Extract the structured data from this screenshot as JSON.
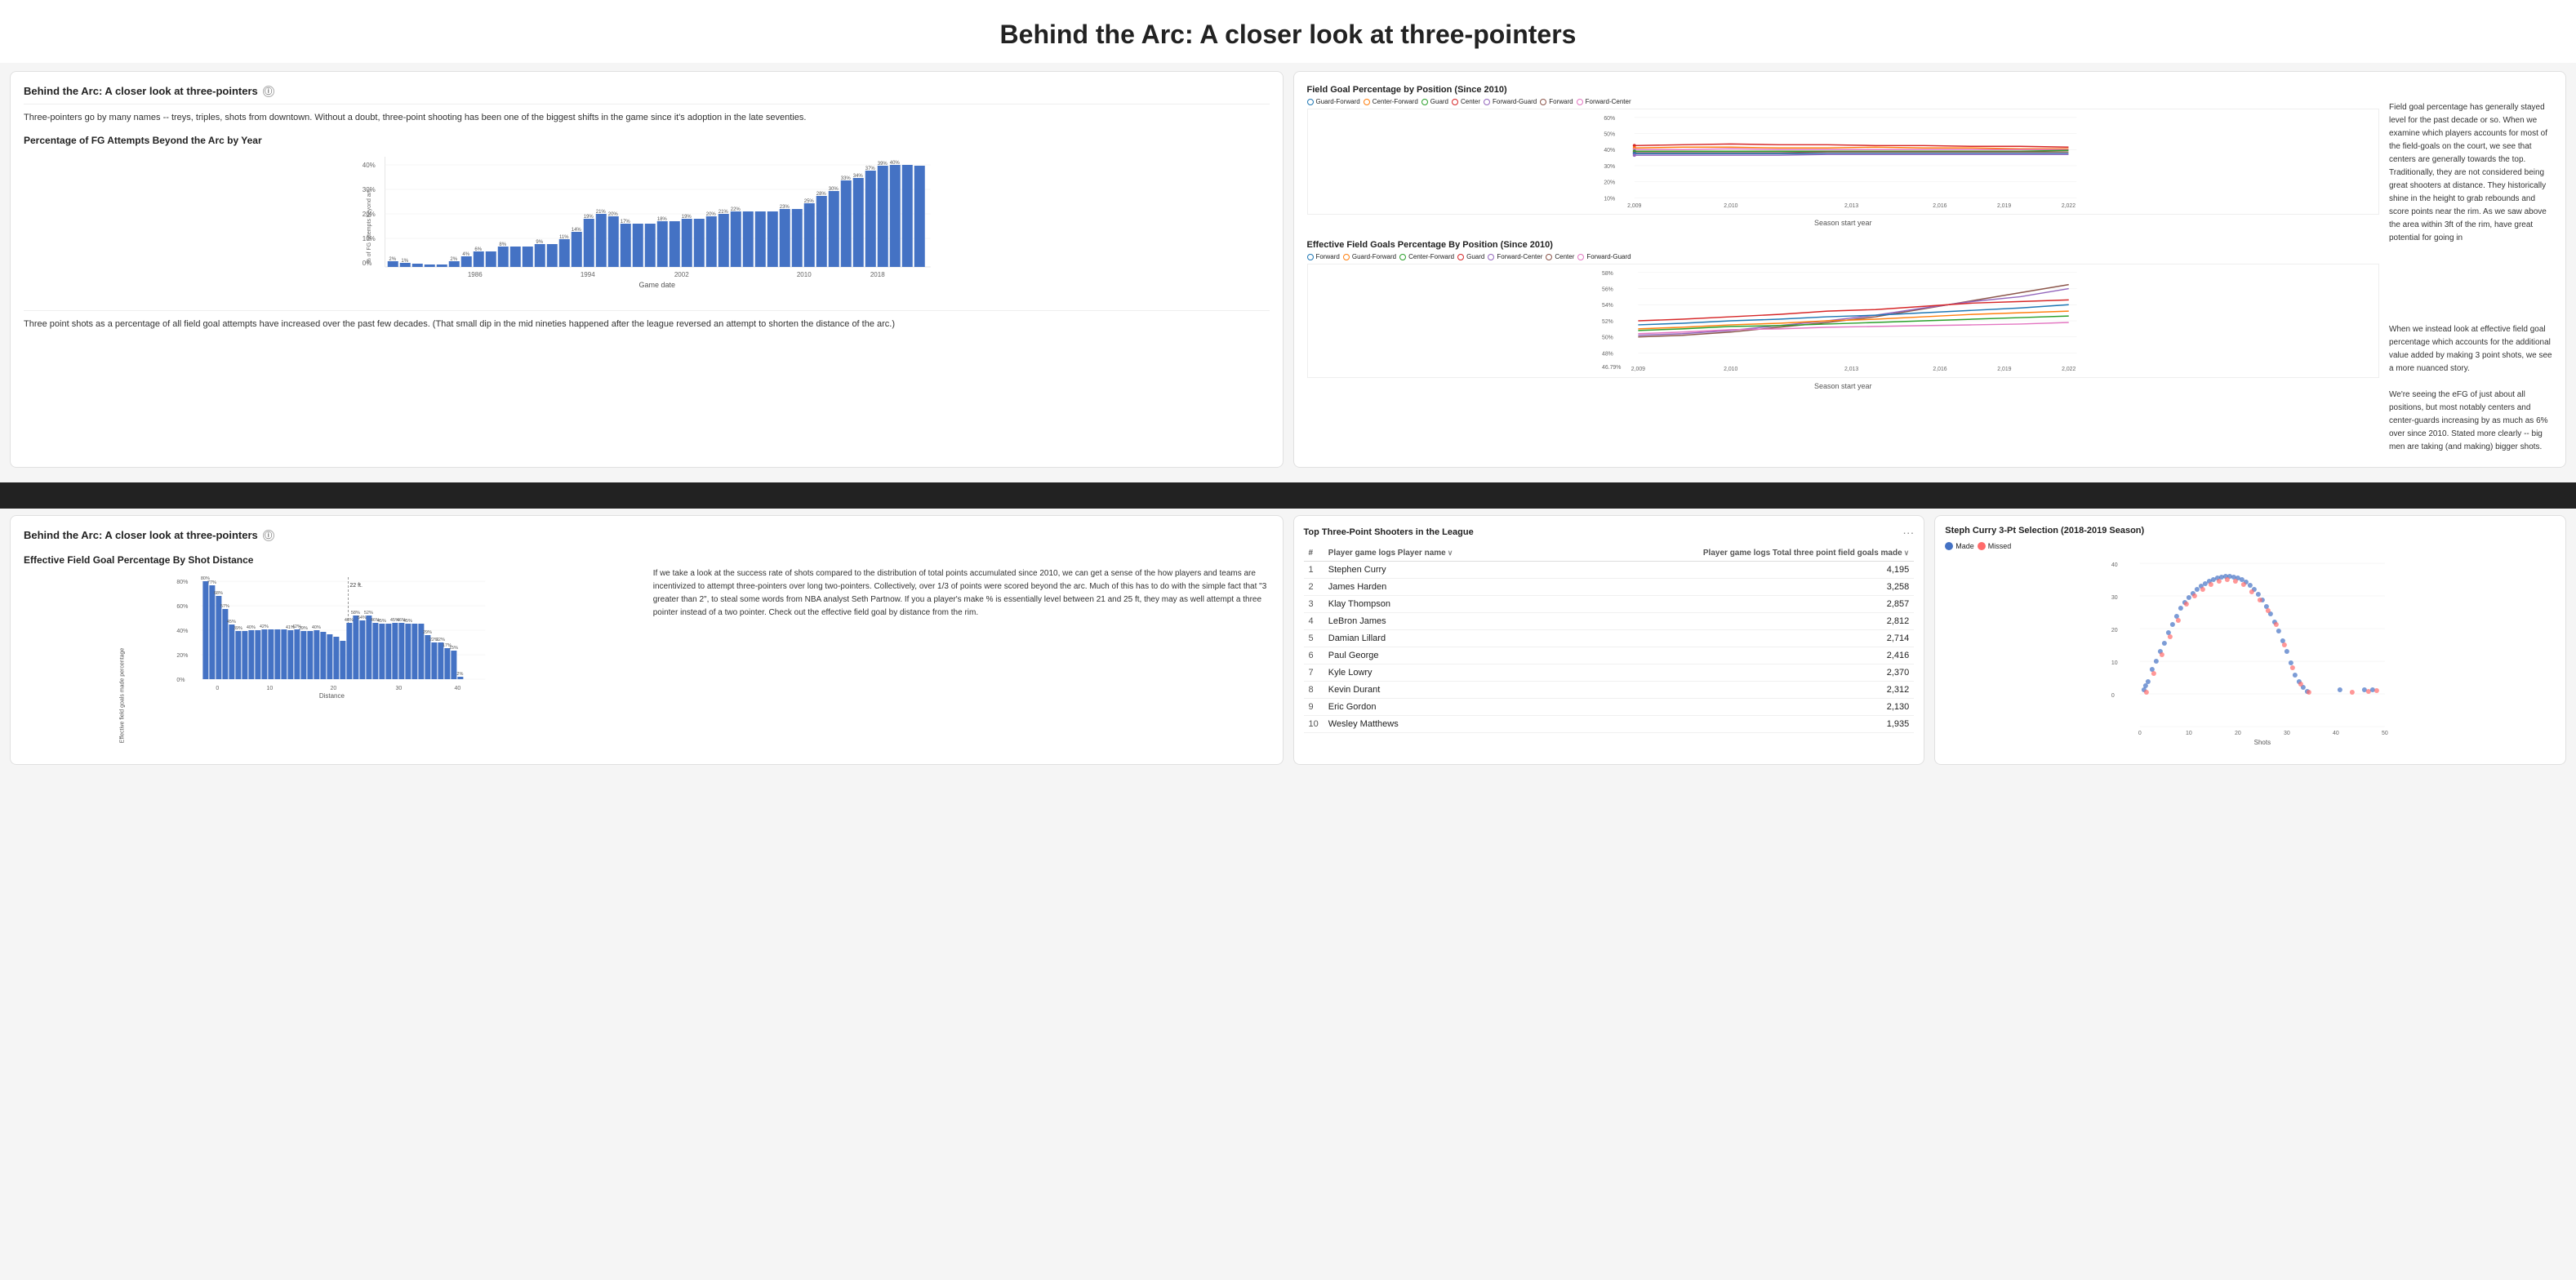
{
  "page": {
    "title": "Behind the Arc: A closer look at three-pointers"
  },
  "top_left": {
    "panel_title": "Behind the Arc: A closer look at three-pointers",
    "intro_text": "Three-pointers go by many names -- treys, triples, shots from downtown. Without a doubt, three-point shooting has been one of the biggest shifts in the game since it's adoption in the late seventies.",
    "chart_title": "Percentage of FG Attempts Beyond the Arc by Year",
    "y_axis_label": "% of FG attempts beyond arc",
    "x_axis_label": "Game date",
    "footer_text": "Three point shots as a percentage of all field goal attempts have increased over the past few decades. (That small dip in the mid nineties happened after the league reversed an attempt to shorten the distance of the arc.)",
    "bar_data": [
      {
        "year": "1980",
        "value": 2,
        "label": "2%"
      },
      {
        "year": "1981",
        "value": 1,
        "label": "1%"
      },
      {
        "year": "1982",
        "value": 0.7,
        "label": "0.7%"
      },
      {
        "year": "1983",
        "value": 0.3,
        "label": "0.3%"
      },
      {
        "year": "1984",
        "value": 0.2,
        "label": "0.2%"
      },
      {
        "year": "1985",
        "value": 2,
        "label": "2%"
      },
      {
        "year": "1986",
        "value": 4,
        "label": "4%"
      },
      {
        "year": "1987",
        "value": 6,
        "label": "6%"
      },
      {
        "year": "1988",
        "value": 6,
        "label": "6%"
      },
      {
        "year": "1989",
        "value": 8,
        "label": "8%"
      },
      {
        "year": "1990",
        "value": 8,
        "label": "8%"
      },
      {
        "year": "1991",
        "value": 8,
        "label": "8%"
      },
      {
        "year": "1992",
        "value": 9,
        "label": "9%"
      },
      {
        "year": "1993",
        "value": 9,
        "label": "9%"
      },
      {
        "year": "1994",
        "value": 11,
        "label": "11%"
      },
      {
        "year": "1995",
        "value": 14,
        "label": "14%"
      },
      {
        "year": "1996",
        "value": 19,
        "label": "19%"
      },
      {
        "year": "1997",
        "value": 21,
        "label": "21%"
      },
      {
        "year": "1998",
        "value": 20,
        "label": "20%"
      },
      {
        "year": "1999",
        "value": 17,
        "label": "17%"
      },
      {
        "year": "2000",
        "value": 17,
        "label": "17%"
      },
      {
        "year": "2001",
        "value": 17,
        "label": "17%"
      },
      {
        "year": "2002",
        "value": 18,
        "label": "18%"
      },
      {
        "year": "2003",
        "value": 18,
        "label": "18%"
      },
      {
        "year": "2004",
        "value": 19,
        "label": "19%"
      },
      {
        "year": "2005",
        "value": 19,
        "label": "19%"
      },
      {
        "year": "2006",
        "value": 20,
        "label": "20%"
      },
      {
        "year": "2007",
        "value": 21,
        "label": "21%"
      },
      {
        "year": "2008",
        "value": 22,
        "label": "22%"
      },
      {
        "year": "2009",
        "value": 22,
        "label": "22%"
      },
      {
        "year": "2010",
        "value": 22,
        "label": "22%"
      },
      {
        "year": "2011",
        "value": 22,
        "label": "22%"
      },
      {
        "year": "2012",
        "value": 23,
        "label": "23%"
      },
      {
        "year": "2013",
        "value": 23,
        "label": "23%"
      },
      {
        "year": "2014",
        "value": 25,
        "label": "25%"
      },
      {
        "year": "2015",
        "value": 28,
        "label": "28%"
      },
      {
        "year": "2016",
        "value": 30,
        "label": "30%"
      },
      {
        "year": "2017",
        "value": 33,
        "label": "33%"
      },
      {
        "year": "2018",
        "value": 34,
        "label": "34%"
      },
      {
        "year": "2019",
        "value": 37,
        "label": "37%"
      },
      {
        "year": "2020",
        "value": 39,
        "label": "39%"
      },
      {
        "year": "2021",
        "value": 40,
        "label": "40%"
      },
      {
        "year": "2022",
        "value": 40,
        "label": "40%"
      },
      {
        "year": "2023",
        "value": 39,
        "label": "39%"
      },
      {
        "year": "2024",
        "value": 39,
        "label": "39%"
      }
    ]
  },
  "top_right": {
    "chart1_title": "Field Goal Percentage by Position (Since 2010)",
    "chart1_legend": [
      {
        "label": "Guard-Forward",
        "color": "#1f77b4"
      },
      {
        "label": "Center-Forward",
        "color": "#ff7f0e"
      },
      {
        "label": "Guard",
        "color": "#2ca02c"
      },
      {
        "label": "Center",
        "color": "#d62728"
      },
      {
        "label": "Forward-Guard",
        "color": "#9467bd"
      },
      {
        "label": "Forward",
        "color": "#8c564b"
      },
      {
        "label": "Forward-Center",
        "color": "#e377c2"
      }
    ],
    "chart1_x_label": "Season start year",
    "chart1_y_max": 60,
    "chart2_title": "Effective Field Goals Percentage By Position (Since 2010)",
    "chart2_legend": [
      {
        "label": "Forward",
        "color": "#1f77b4"
      },
      {
        "label": "Guard-Forward",
        "color": "#ff7f0e"
      },
      {
        "label": "Center-Forward",
        "color": "#2ca02c"
      },
      {
        "label": "Guard",
        "color": "#d62728"
      },
      {
        "label": "Forward-Center",
        "color": "#9467bd"
      },
      {
        "label": "Center",
        "color": "#8c564b"
      },
      {
        "label": "Forward-Guard",
        "color": "#e377c2"
      }
    ],
    "chart2_x_label": "Season start year",
    "text1": "Field goal percentage has generally stayed level for the past decade or so. When we examine which players accounts for most of the field-goals on the court, we see that centers are generally towards the top. Traditionally, they are not considered being great shooters at distance. They historically shine in the height to grab rebounds and score points near the rim. As we saw above the area within 3ft of the rim, have great potential for going in",
    "text2": "When we instead look at effective field goal percentage which accounts for the additional value added by making 3 point shots, we see a more nuanced story.\n\nWe're seeing the eFG of just about all positions, but most notably centers and center-guards increasing by as much as 6% over since 2010. Stated more clearly -- big men are taking (and making) bigger shots."
  },
  "bottom_left": {
    "panel_title": "Behind the Arc: A closer look at three-pointers",
    "chart_title": "Effective Field Goal Percentage By Shot Distance",
    "y_axis_label": "Effective field goals made percentage",
    "x_axis_label": "Distance",
    "text": "If we take a look at the success rate of shots compared to the distribution of total points accumulated since 2010, we can get a sense of the how players and teams are incentivized to attempt three-pointers over long two-pointers. Collectively, over 1/3 of points were scored beyond the arc. Much of this has to do with the simple fact that \"3 greater than 2\", to steal some words from NBA analyst Seth Partnow.\n\nIf you a player's make % is essentially level between 21 and 25 ft, they may as well attempt a three pointer instead of a two pointer. Check out the effective field goal by distance from the rim.",
    "bar_data": [
      {
        "dist": "0",
        "val": 80,
        "label": "80%"
      },
      {
        "dist": "1",
        "val": 77,
        "label": "77%"
      },
      {
        "dist": "2",
        "val": 68,
        "label": "68%"
      },
      {
        "dist": "3",
        "val": 57,
        "label": "57%"
      },
      {
        "dist": "4",
        "val": 45,
        "label": "45%"
      },
      {
        "dist": "5",
        "val": 39,
        "label": "39%"
      },
      {
        "dist": "6",
        "val": 39,
        "label": "39%"
      },
      {
        "dist": "7",
        "val": 40,
        "label": "40%"
      },
      {
        "dist": "8",
        "val": 40,
        "label": "40%"
      },
      {
        "dist": "9",
        "val": 42,
        "label": "42%"
      },
      {
        "dist": "10",
        "val": 42,
        "label": "42%"
      },
      {
        "dist": "11",
        "val": 42,
        "label": "42%"
      },
      {
        "dist": "12",
        "val": 42,
        "label": "42%"
      },
      {
        "dist": "13",
        "val": 41,
        "label": "41%"
      },
      {
        "dist": "14",
        "val": 42,
        "label": "42%"
      },
      {
        "dist": "15",
        "val": 39,
        "label": "39%"
      },
      {
        "dist": "16",
        "val": 39,
        "label": "39%"
      },
      {
        "dist": "17",
        "val": 40,
        "label": "40%"
      },
      {
        "dist": "18",
        "val": 38,
        "label": ""
      },
      {
        "dist": "19",
        "val": 35,
        "label": ""
      },
      {
        "dist": "20",
        "val": 33,
        "label": ""
      },
      {
        "dist": "21",
        "val": 30,
        "label": ""
      },
      {
        "dist": "22ft",
        "val": 46,
        "label": "46%"
      },
      {
        "dist": "23",
        "val": 58,
        "label": "58%"
      },
      {
        "dist": "24",
        "val": 54,
        "label": "54%"
      },
      {
        "dist": "25",
        "val": 52,
        "label": "52%"
      },
      {
        "dist": "26",
        "val": 46,
        "label": "46%"
      },
      {
        "dist": "27",
        "val": 45,
        "label": "45%"
      },
      {
        "dist": "28",
        "val": 45,
        "label": "45%"
      },
      {
        "dist": "29",
        "val": 46,
        "label": "46%"
      },
      {
        "dist": "30",
        "val": 45,
        "label": "45%"
      },
      {
        "dist": "31",
        "val": 45,
        "label": "45%"
      },
      {
        "dist": "32",
        "val": 45,
        "label": "45%"
      },
      {
        "dist": "33",
        "val": 29,
        "label": "29%"
      },
      {
        "dist": "34",
        "val": 22,
        "label": "22%"
      },
      {
        "dist": "35",
        "val": 22,
        "label": "22%"
      },
      {
        "dist": "36",
        "val": 17,
        "label": "17%"
      },
      {
        "dist": "37",
        "val": 15,
        "label": "15%"
      },
      {
        "dist": "38",
        "val": 2,
        "label": "2%"
      }
    ],
    "annotation": "22 ft."
  },
  "bottom_right": {
    "table_title": "Top Three-Point Shooters in the League",
    "table_col1": "#",
    "table_col2_header": "Player game logs Player name",
    "table_col3_header": "Player game logs Total three point field goals made",
    "table_rows": [
      {
        "rank": 1,
        "name": "Stephen Curry",
        "value": 4195
      },
      {
        "rank": 2,
        "name": "James Harden",
        "value": 3258
      },
      {
        "rank": 3,
        "name": "Klay Thompson",
        "value": 2857
      },
      {
        "rank": 4,
        "name": "LeBron James",
        "value": 2812
      },
      {
        "rank": 5,
        "name": "Damian Lillard",
        "value": 2714
      },
      {
        "rank": 6,
        "name": "Paul George",
        "value": 2416
      },
      {
        "rank": 7,
        "name": "Kyle Lowry",
        "value": 2370
      },
      {
        "rank": 8,
        "name": "Kevin Durant",
        "value": 2312
      },
      {
        "rank": 9,
        "name": "Eric Gordon",
        "value": 2130
      },
      {
        "rank": 10,
        "name": "Wesley Matthews",
        "value": 1935
      }
    ],
    "scatter_title": "Steph Curry 3-Pt Selection (2018-2019 Season)",
    "scatter_legend_made": "Made",
    "scatter_legend_missed": "Missed",
    "scatter_x_label": "Shots",
    "scatter_y_label": "",
    "made_color": "#4472C4",
    "missed_color": "#FF6B6B"
  }
}
